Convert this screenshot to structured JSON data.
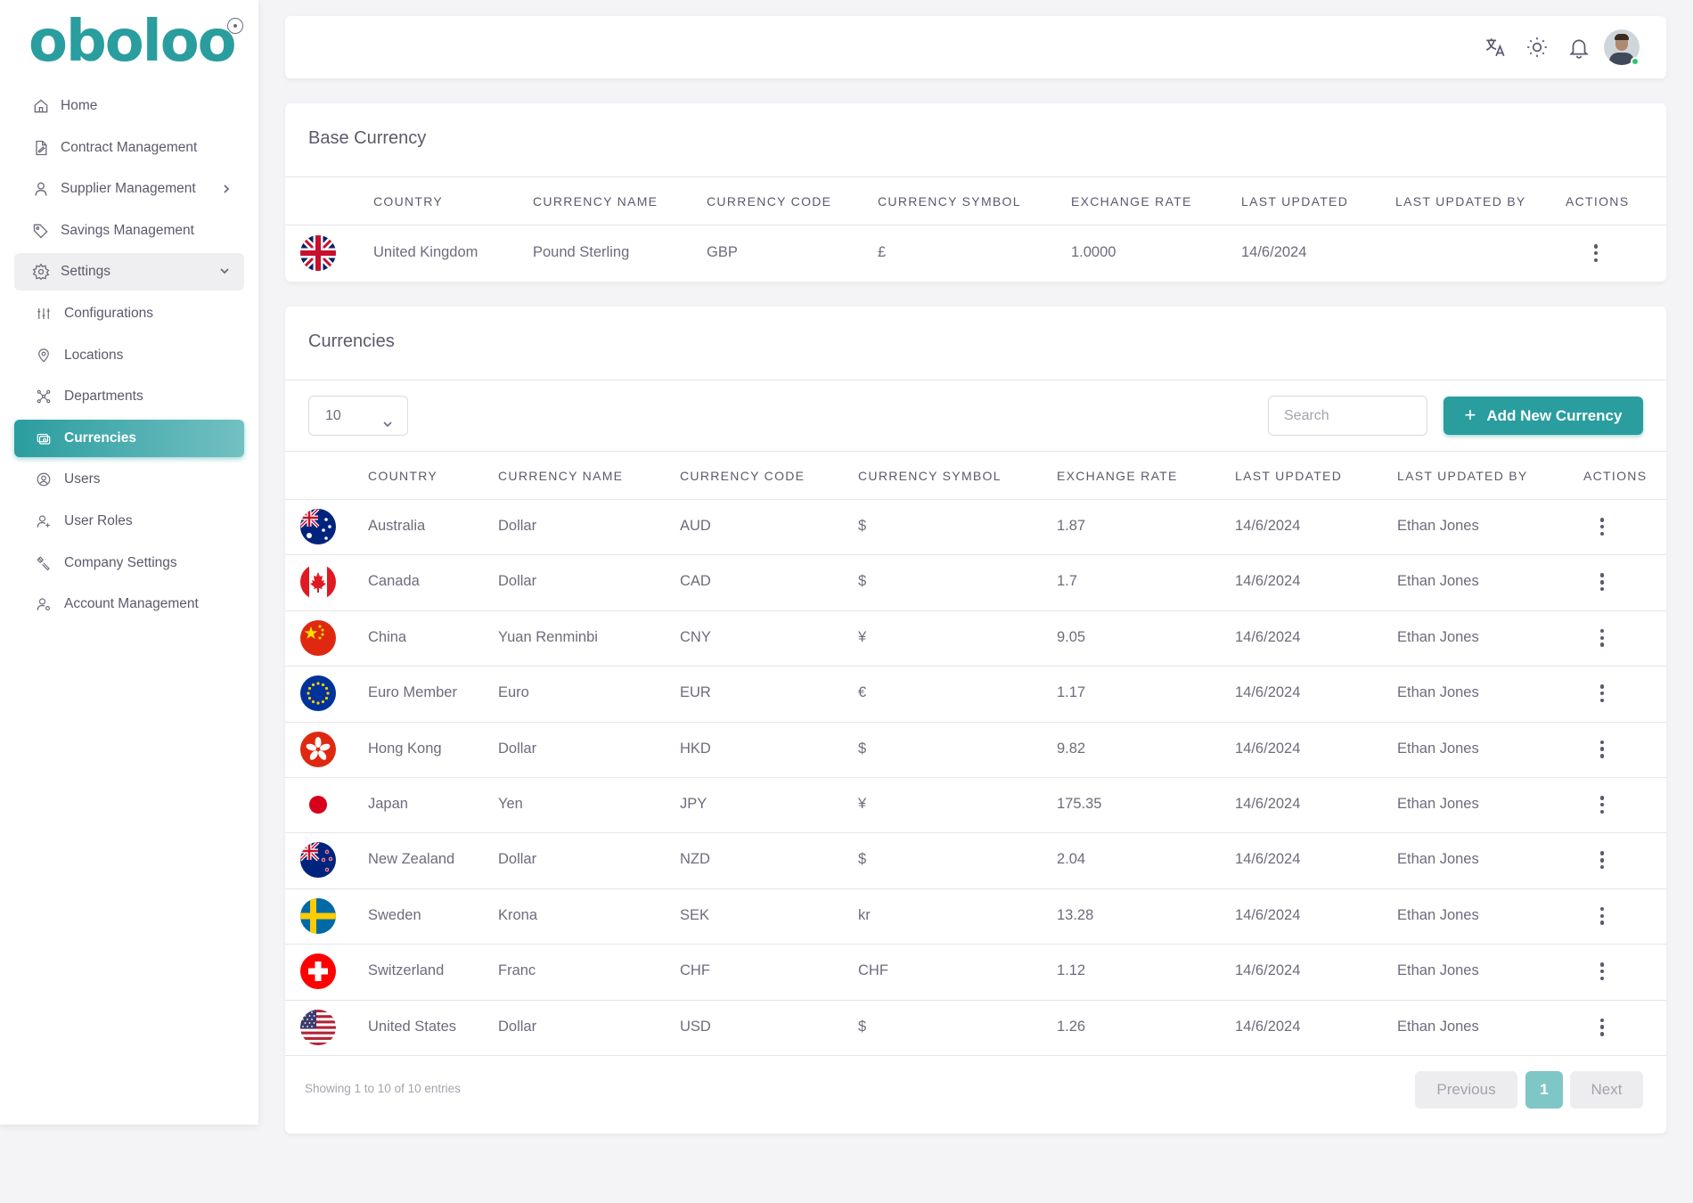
{
  "brand": {
    "logo": "oboloo"
  },
  "sidebar": {
    "items": [
      {
        "label": "Home",
        "icon": "home-icon"
      },
      {
        "label": "Contract Management",
        "icon": "contract-icon"
      },
      {
        "label": "Supplier Management",
        "icon": "user-icon"
      },
      {
        "label": "Savings Management",
        "icon": "tag-icon"
      },
      {
        "label": "Settings",
        "icon": "settings-icon"
      },
      {
        "label": "Configurations",
        "icon": "sliders-icon"
      },
      {
        "label": "Locations",
        "icon": "location-icon"
      },
      {
        "label": "Departments",
        "icon": "departments-icon"
      },
      {
        "label": "Currencies",
        "icon": "currency-icon"
      },
      {
        "label": "Users",
        "icon": "users-icon"
      },
      {
        "label": "User Roles",
        "icon": "user-plus-icon"
      },
      {
        "label": "Company Settings",
        "icon": "tools-icon"
      },
      {
        "label": "Account Management",
        "icon": "account-icon"
      }
    ]
  },
  "topbar": {
    "icons": [
      "translate-icon",
      "sun-icon",
      "bell-icon",
      "avatar"
    ]
  },
  "base_currency": {
    "title": "Base Currency",
    "headers": [
      "COUNTRY",
      "CURRENCY NAME",
      "CURRENCY CODE",
      "CURRENCY SYMBOL",
      "EXCHANGE RATE",
      "LAST UPDATED",
      "LAST UPDATED BY",
      "ACTIONS"
    ],
    "row": {
      "country": "United Kingdom",
      "name": "Pound Sterling",
      "code": "GBP",
      "symbol": "£",
      "rate": "1.0000",
      "updated": "14/6/2024",
      "by": ""
    }
  },
  "currencies": {
    "title": "Currencies",
    "page_length": "10",
    "search_placeholder": "Search",
    "add_button": "Add New Currency",
    "headers": [
      "COUNTRY",
      "CURRENCY NAME",
      "CURRENCY CODE",
      "CURRENCY SYMBOL",
      "EXCHANGE RATE",
      "LAST UPDATED",
      "LAST UPDATED BY",
      "ACTIONS"
    ],
    "rows": [
      {
        "country": "Australia",
        "name": "Dollar",
        "code": "AUD",
        "symbol": "$",
        "rate": "1.87",
        "updated": "14/6/2024",
        "by": "Ethan Jones"
      },
      {
        "country": "Canada",
        "name": "Dollar",
        "code": "CAD",
        "symbol": "$",
        "rate": "1.7",
        "updated": "14/6/2024",
        "by": "Ethan Jones"
      },
      {
        "country": "China",
        "name": "Yuan Renminbi",
        "code": "CNY",
        "symbol": "¥",
        "rate": "9.05",
        "updated": "14/6/2024",
        "by": "Ethan Jones"
      },
      {
        "country": "Euro Member",
        "name": "Euro",
        "code": "EUR",
        "symbol": "€",
        "rate": "1.17",
        "updated": "14/6/2024",
        "by": "Ethan Jones"
      },
      {
        "country": "Hong Kong",
        "name": "Dollar",
        "code": "HKD",
        "symbol": "$",
        "rate": "9.82",
        "updated": "14/6/2024",
        "by": "Ethan Jones"
      },
      {
        "country": "Japan",
        "name": "Yen",
        "code": "JPY",
        "symbol": "¥",
        "rate": "175.35",
        "updated": "14/6/2024",
        "by": "Ethan Jones"
      },
      {
        "country": "New Zealand",
        "name": "Dollar",
        "code": "NZD",
        "symbol": "$",
        "rate": "2.04",
        "updated": "14/6/2024",
        "by": "Ethan Jones"
      },
      {
        "country": "Sweden",
        "name": "Krona",
        "code": "SEK",
        "symbol": "kr",
        "rate": "13.28",
        "updated": "14/6/2024",
        "by": "Ethan Jones"
      },
      {
        "country": "Switzerland",
        "name": "Franc",
        "code": "CHF",
        "symbol": "CHF",
        "rate": "1.12",
        "updated": "14/6/2024",
        "by": "Ethan Jones"
      },
      {
        "country": "United States",
        "name": "Dollar",
        "code": "USD",
        "symbol": "$",
        "rate": "1.26",
        "updated": "14/6/2024",
        "by": "Ethan Jones"
      }
    ],
    "info": "Showing 1 to 10 of 10 entries",
    "pagination": {
      "previous": "Previous",
      "current": "1",
      "next": "Next"
    }
  },
  "colors": {
    "accent": "#2a9d9f",
    "accent_light": "#7fc6c7",
    "text": "#5d596c",
    "background": "#f4f4f6"
  }
}
